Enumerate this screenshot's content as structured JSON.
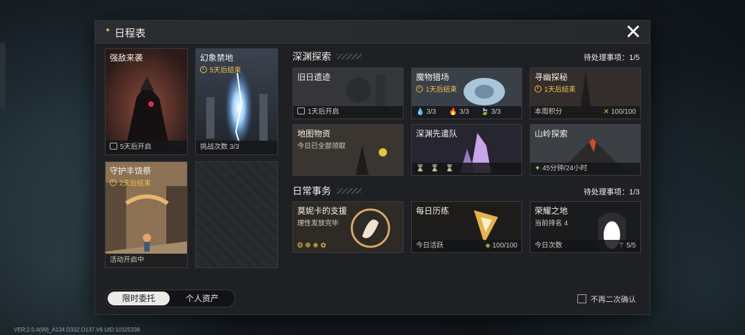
{
  "panel": {
    "title": "日程表"
  },
  "left": {
    "strong_enemy": {
      "name": "强敌来袭",
      "footer": "5天后开启"
    },
    "illusion": {
      "name": "幻象禁地",
      "timer": "5天后结束",
      "footer": "挑战次数 3/3"
    },
    "harvest": {
      "name": "守护丰饶祭",
      "timer": "2天后结束",
      "footer": "活动开启中"
    }
  },
  "abyss": {
    "title": "深渊探索",
    "pending": "待处理事项：1/5",
    "cards": [
      {
        "name": "旧日遗迹",
        "footer": "1天后开启"
      },
      {
        "name": "魔物猎场",
        "timer": "1天后结束",
        "counts": [
          "3/3",
          "3/3",
          "3/3"
        ]
      },
      {
        "name": "寻幽探秘",
        "timer": "1天后结束",
        "footer_left": "本周积分",
        "footer_right": "100/100"
      },
      {
        "name": "地图物资",
        "sub": "今日已全部领取"
      },
      {
        "name": "深渊先遣队"
      },
      {
        "name": "山岭探索",
        "footer": "45分钟/24小时"
      }
    ]
  },
  "daily": {
    "title": "日常事务",
    "pending": "待处理事项：1/3",
    "cards": [
      {
        "name": "莫妮卡的支援",
        "sub": "理性发放完毕"
      },
      {
        "name": "每日历练",
        "footer_left": "今日活跃",
        "footer_right": "100/100"
      },
      {
        "name": "荣耀之地",
        "sub_label": "当前排名",
        "sub_value": "4",
        "footer_left": "今日次数",
        "footer_right": "5/5"
      }
    ]
  },
  "tabs": {
    "active": "限时委托",
    "inactive": "个人资产"
  },
  "confirm_label": "不再二次确认",
  "version": "VER:2.0.4(99)_A134.D332.O137.V6   UID:10325338",
  "colors": {
    "gold": "#f0c14b",
    "panel": "#1e2024"
  }
}
